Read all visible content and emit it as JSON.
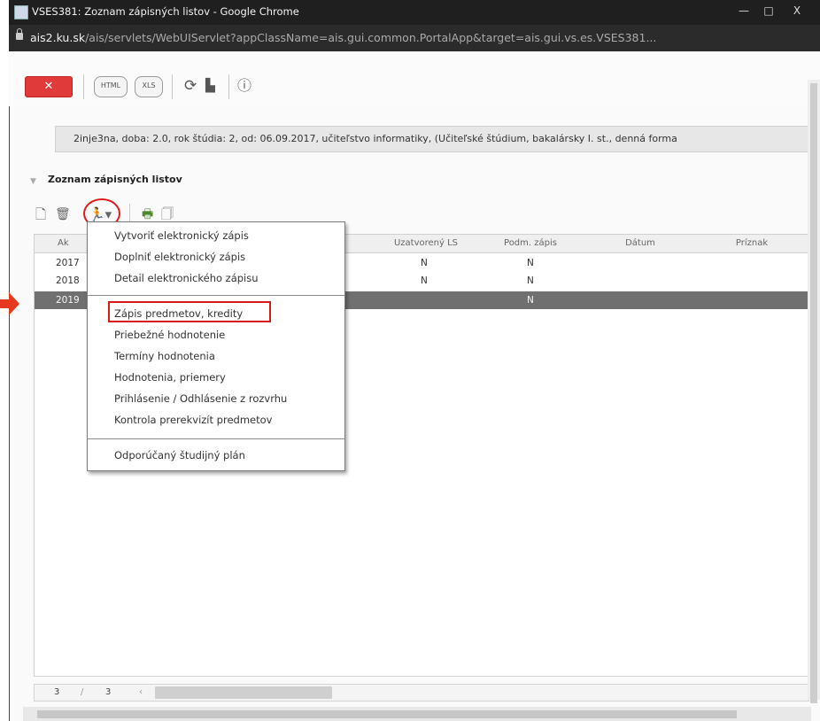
{
  "window": {
    "title": "VSES381: Zoznam zápisných listov - Google Chrome",
    "controls": {
      "minimize": "—",
      "maximize": "□",
      "close": "X"
    }
  },
  "address": {
    "host": "ais2.ku.sk",
    "path": "/ais/servlets/WebUIServlet?appClassName=ais.gui.common.PortalApp&target=ais.gui.vs.es.VSES381..."
  },
  "toolbar": {
    "close_label": "✕",
    "html_label": "HTML",
    "xls_label": "XLS"
  },
  "info_bar": "2inje3na, doba: 2.0, rok štúdia: 2, od: 06.09.2017, učiteľstvo informatiky, (Učiteľské štúdium, bakalársky I. st., denná forma",
  "section": {
    "title": "Zoznam zápisných listov"
  },
  "table": {
    "columns": [
      "Ak",
      "Uzatvorený LS",
      "Podm. zápis",
      "Dátum",
      "Príznak"
    ],
    "rows": [
      {
        "year": "2017",
        "uzatvoreny": "N",
        "podm": "N",
        "selected": false
      },
      {
        "year": "2018",
        "uzatvoreny": "N",
        "podm": "N",
        "selected": false
      },
      {
        "year": "2019",
        "uzatvoreny": "",
        "podm": "N",
        "selected": true
      }
    ]
  },
  "menu": {
    "items": [
      "Vytvoriť elektronický zápis",
      "Doplniť elektronický zápis",
      "Detail elektronického zápisu",
      "Zápis predmetov, kredity",
      "Priebežné hodnotenie",
      "Termíny hodnotenia",
      "Hodnotenia, priemery",
      "Prihlásenie / Odhlásenie z rozvrhu",
      "Kontrola prerekvizít predmetov",
      "Odporúčaný študijný plán"
    ]
  },
  "pager": {
    "current": "3",
    "separator": "/",
    "total": "3",
    "prev": "‹"
  },
  "colors": {
    "close_button": "#e03a3a",
    "highlight": "#d61a1a",
    "selected_row": "#707070",
    "arrow": "#e53a1e"
  }
}
